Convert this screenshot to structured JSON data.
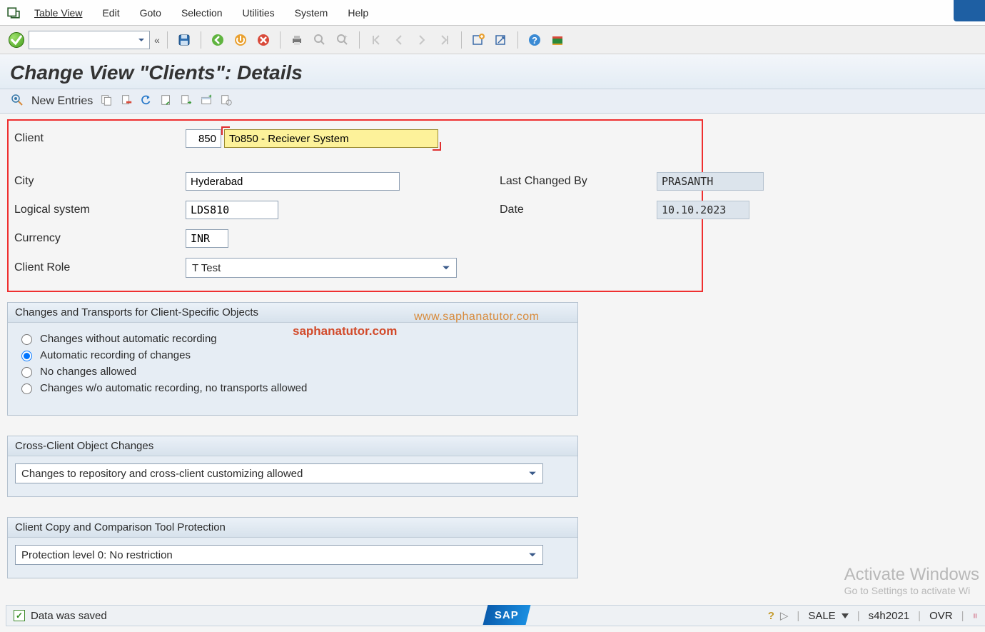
{
  "menubar": {
    "items": [
      "Table View",
      "Edit",
      "Goto",
      "Selection",
      "Utilities",
      "System",
      "Help"
    ]
  },
  "title": "Change View \"Clients\": Details",
  "app_toolbar": {
    "new_entries": "New Entries"
  },
  "fields": {
    "client_label": "Client",
    "client_id": "850",
    "client_name": "To850 - Reciever System",
    "city_label": "City",
    "city": "Hyderabad",
    "last_changed_label": "Last Changed By",
    "last_changed_by": "PRASANTH",
    "logical_system_label": "Logical system",
    "logical_system": "LDS810",
    "date_label": "Date",
    "date": "10.10.2023",
    "currency_label": "Currency",
    "currency": "INR",
    "client_role_label": "Client Role",
    "client_role": "T Test"
  },
  "group1": {
    "title": "Changes and Transports for Client-Specific Objects",
    "opt1": "Changes without automatic recording",
    "opt2": "Automatic recording of changes",
    "opt3": "No changes allowed",
    "opt4": "Changes w/o automatic recording, no transports allowed"
  },
  "group2": {
    "title": "Cross-Client Object Changes",
    "value": "Changes to repository and cross-client customizing allowed"
  },
  "group3": {
    "title": "Client Copy and Comparison Tool Protection",
    "value": "Protection level 0: No restriction"
  },
  "watermark1": "www.saphanatutor.com",
  "watermark2": "saphanatutor.com",
  "win_wm1": "Activate Windows",
  "win_wm2": "Go to Settings to activate Wi",
  "status": {
    "message": "Data was saved",
    "tcode": "SALE",
    "system": "s4h2021",
    "mode": "OVR"
  },
  "sap_logo": "SAP"
}
